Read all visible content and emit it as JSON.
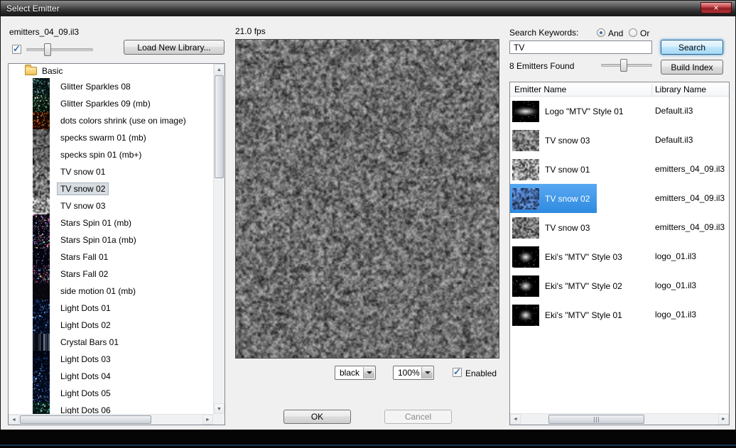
{
  "window": {
    "title": "Select Emitter"
  },
  "icons": {
    "close": "×",
    "scroll_up": "▲",
    "scroll_down": "▼",
    "scroll_left": "◄",
    "scroll_right": "►"
  },
  "left_panel": {
    "library_label": "emitters_04_09.il3",
    "load_button_label": "Load New Library...",
    "folder_label": "Basic",
    "items": [
      {
        "label": "Glitter Sparkles 08",
        "thumb": "sparkle-teal"
      },
      {
        "label": "Glitter Sparkles 09 (mb)",
        "thumb": "sparkle-teal2"
      },
      {
        "label": "dots colors shrink (use on image)",
        "thumb": "dots-warm"
      },
      {
        "label": "specks swarm 01 (mb)",
        "thumb": "noise-sparse"
      },
      {
        "label": "specks spin 01 (mb+)",
        "thumb": "noise-sparse"
      },
      {
        "label": "TV snow 01",
        "thumb": "noise"
      },
      {
        "label": "TV snow 02",
        "thumb": "noise",
        "selected": true
      },
      {
        "label": "TV snow 03",
        "thumb": "noise-light"
      },
      {
        "label": "Stars Spin 01 (mb)",
        "thumb": "stars-color"
      },
      {
        "label": "Stars Spin 01a (mb)",
        "thumb": "stars-color"
      },
      {
        "label": "Stars Fall 01",
        "thumb": "stars-sparse"
      },
      {
        "label": "Stars Fall 02",
        "thumb": "stars-color"
      },
      {
        "label": "side motion 01 (mb)",
        "thumb": "dark"
      },
      {
        "label": "Light Dots 01",
        "thumb": "dots-blue"
      },
      {
        "label": "Light Dots 02",
        "thumb": "dots-blue"
      },
      {
        "label": "Crystal Bars 01",
        "thumb": "bars"
      },
      {
        "label": "Light Dots 03",
        "thumb": "dots-blue-dark"
      },
      {
        "label": "Light Dots 04",
        "thumb": "dots-blue"
      },
      {
        "label": "Light Dots 05",
        "thumb": "dots-blue"
      },
      {
        "label": "Light Dots 06",
        "thumb": "dots-cyan"
      }
    ]
  },
  "preview": {
    "fps_label": "21.0 fps",
    "background_value": "black",
    "zoom_value": "100%",
    "enabled_label": "Enabled",
    "ok_label": "OK",
    "cancel_label": "Cancel"
  },
  "search_panel": {
    "keywords_label": "Search Keywords:",
    "and_label": "And",
    "or_label": "Or",
    "query": "TV",
    "search_button_label": "Search",
    "results_label": "8 Emitters Found",
    "build_index_label": "Build Index",
    "columns": [
      "Emitter Name",
      "Library Name"
    ],
    "rows": [
      {
        "name": "Logo \"MTV\" Style 01",
        "library": "Default.il3",
        "thumb": "mtv"
      },
      {
        "name": "TV snow 03",
        "library": "Default.il3",
        "thumb": "noise"
      },
      {
        "name": "TV snow 01",
        "library": "emitters_04_09.il3",
        "thumb": "noise-light"
      },
      {
        "name": "TV snow 02",
        "library": "emitters_04_09.il3",
        "thumb": "noise-blue",
        "selected": true
      },
      {
        "name": "TV snow 03",
        "library": "emitters_04_09.il3",
        "thumb": "noise"
      },
      {
        "name": "Eki's \"MTV\" Style 03",
        "library": "logo_01.il3",
        "thumb": "mtv-small"
      },
      {
        "name": "Eki's \"MTV\" Style 02",
        "library": "logo_01.il3",
        "thumb": "mtv-small"
      },
      {
        "name": "Eki's \"MTV\" Style 01",
        "library": "logo_01.il3",
        "thumb": "mtv-small"
      }
    ]
  }
}
